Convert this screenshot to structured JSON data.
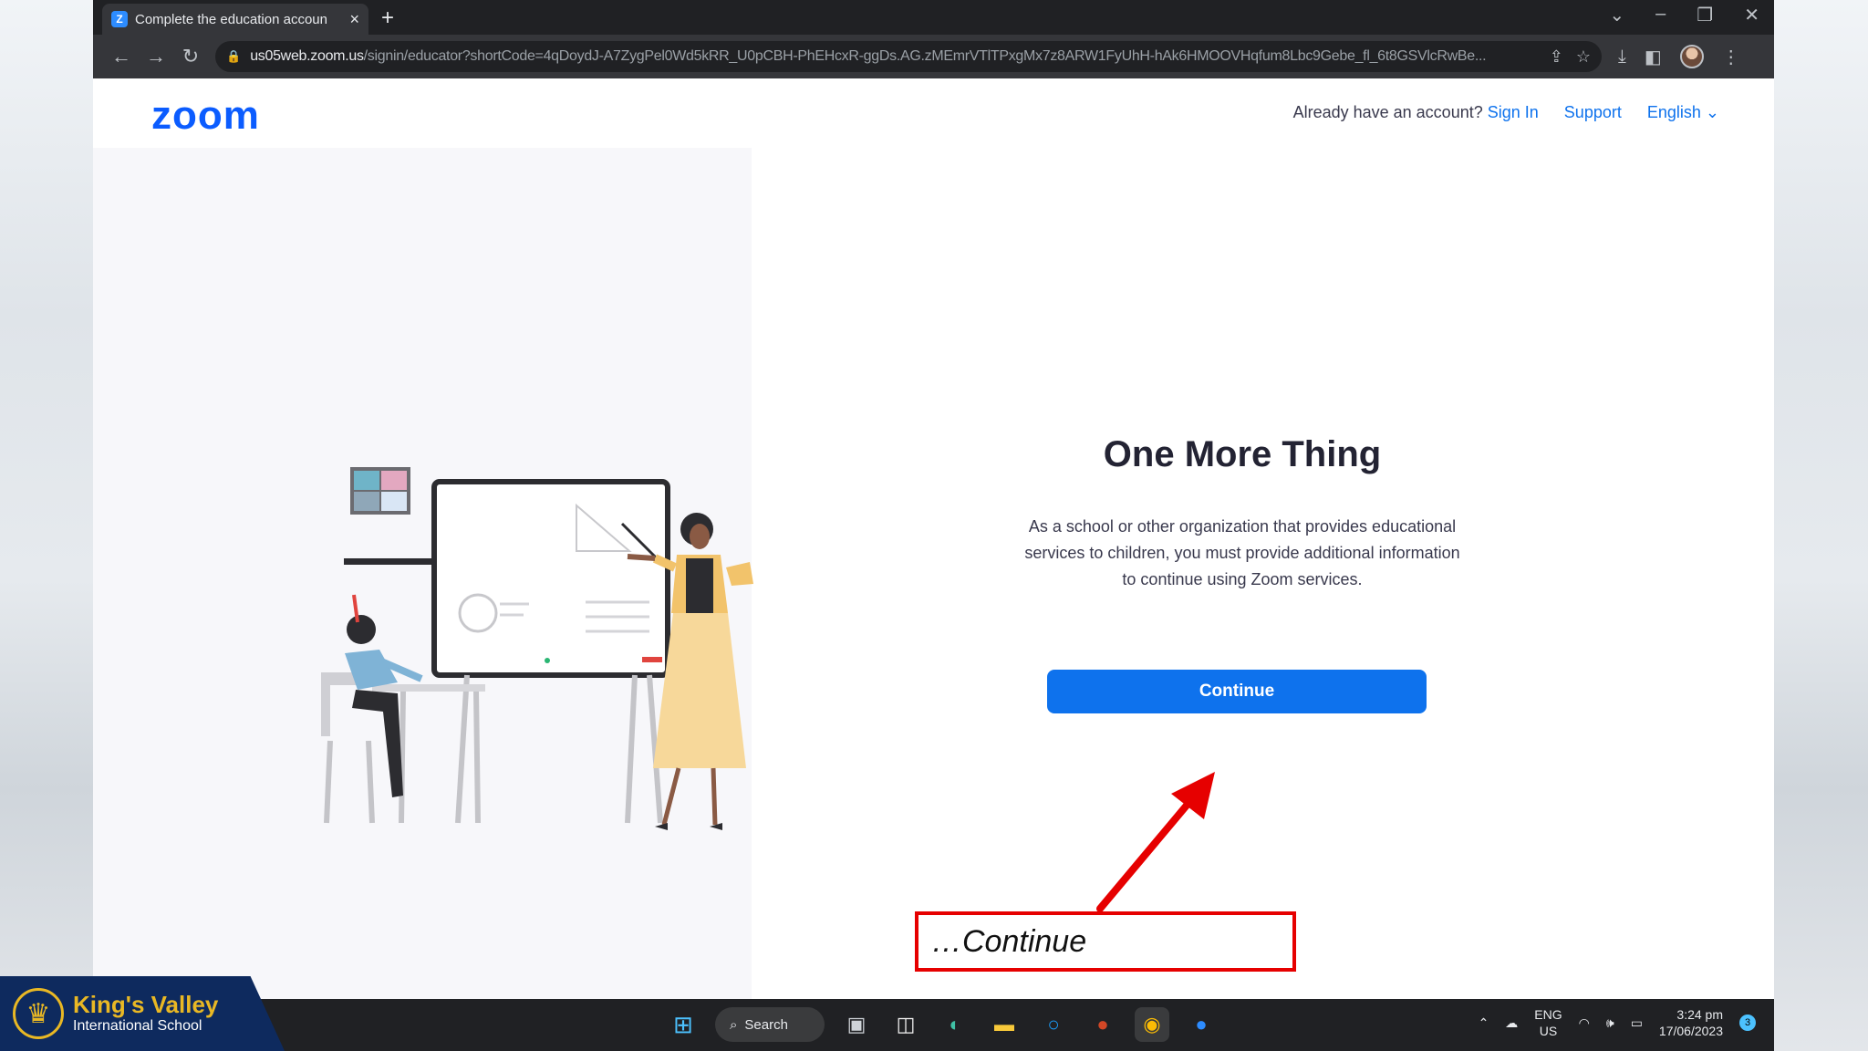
{
  "browser": {
    "tab_title": "Complete the education account",
    "tab_favicon": "Z",
    "tab_close": "×",
    "new_tab": "+",
    "url_host": "us05web.zoom.us",
    "url_path": "/signin/educator?shortCode=4qDoydJ-A7ZygPel0Wd5kRR_U0pCBH-PhEHcxR-ggDs.AG.zMEmrVTlTPxgMx7z8ARW1FyUhH-hAk6HMOOVHqfum8Lbc9Gebe_fl_6t8GSVlcRwBe..."
  },
  "zoom": {
    "logo": "zoom",
    "already_text": "Already have an account?",
    "sign_in": "Sign In",
    "support": "Support",
    "language": "English",
    "language_chevron": "⌄"
  },
  "main": {
    "headline": "One More Thing",
    "description": "As a school or other organization that provides educational services to children, you must provide additional information to continue using Zoom services.",
    "continue_label": "Continue"
  },
  "annotation": {
    "callout_text": "…Continue",
    "color": "#e60000"
  },
  "taskbar": {
    "search_label": "Search",
    "lang_top": "ENG",
    "lang_bottom": "US",
    "time": "3:24 pm",
    "date": "17/06/2023",
    "notification_count": "3"
  },
  "brand": {
    "name": "King's Valley",
    "sub": "International School"
  },
  "colors": {
    "zoom_blue": "#0e72ed",
    "logo_blue": "#0b5cff",
    "brand_navy": "#0e2a5e",
    "brand_gold": "#e9b824"
  }
}
